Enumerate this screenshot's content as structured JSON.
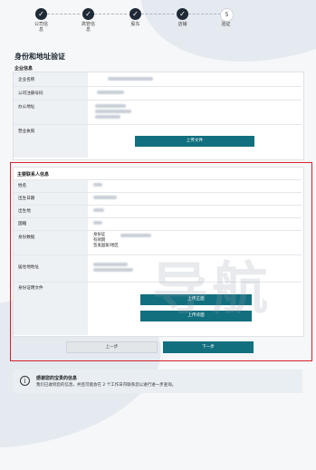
{
  "stepper": {
    "steps": [
      {
        "label_line1": "公司信",
        "label_line2": "息",
        "number": "✓"
      },
      {
        "label_line1": "高管信",
        "label_line2": "息",
        "number": "✓"
      },
      {
        "label_line1": "股东",
        "label_line2": "",
        "number": "✓"
      },
      {
        "label_line1": "店铺",
        "label_line2": "",
        "number": "✓"
      },
      {
        "label_line1": "验证",
        "label_line2": "",
        "number": "5"
      }
    ]
  },
  "page_title": "身份和地址验证",
  "company_section": {
    "title": "企业信息",
    "rows": {
      "name_label": "企业名称",
      "reg_no_label": "公司注册号码",
      "address_label": "办公地址",
      "license_label": "营业执照"
    },
    "upload_button": "上传文件"
  },
  "contact_section": {
    "title": "主要联系人信息",
    "rows": {
      "name_label": "姓名",
      "dob_label": "出生日期",
      "birthplace_label": "出生地",
      "nationality_label": "国籍",
      "id_data_label": "身份数据",
      "id_type_1": "身份证",
      "id_type_2": "有效期",
      "id_type_3": "签发国家/地区",
      "residence_label": "居住地地址",
      "id_docs_label": "身份证明文件"
    },
    "upload_front_button": "上传正面",
    "upload_back_button": "上传背面"
  },
  "nav": {
    "prev_button": "上一步",
    "next_button": "下一步"
  },
  "watermark": "导航",
  "notice": {
    "icon": "info-icon",
    "title": "感谢您的宝贵的信息",
    "body": "我们已收到您的信息，并且可能会在 2 个工作日内联系您以进行进一步查询。"
  },
  "colors": {
    "teal": "#116f7e",
    "highlight": "#d3212c",
    "stepper": "#1f2a36"
  }
}
